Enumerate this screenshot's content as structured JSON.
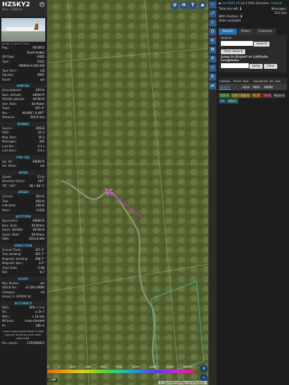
{
  "aircraft": {
    "registration": "HZSKY2",
    "hex_label": "Hex:",
    "hex": "719023",
    "photo_credit": "Image © Jose M. Deza",
    "rows_id": [
      {
        "k": "Reg.:",
        "v": "HZ-SKY2"
      },
      {
        "k": "",
        "v": "Saudi Arabia"
      },
      {
        "k": "DB flags:",
        "v": "LADD"
      },
      {
        "k": "Type:",
        "v": "A332"
      },
      {
        "k": "",
        "v": "AIRBUS A-330-200"
      },
      {
        "k": "Type Desc.:",
        "v": "L2J"
      },
      {
        "k": "Squawk:",
        "v": "0601"
      },
      {
        "k": "Route:",
        "v": "n/a"
      }
    ]
  },
  "sections": [
    {
      "title": "SPATIAL",
      "rows": [
        {
          "k": "Groundspeed:",
          "v": "429 kt"
        },
        {
          "k": "Baro. altitude:",
          "v": "40000 ft"
        },
        {
          "k": "WGS84 altitude:",
          "v": "40700 ft"
        },
        {
          "k": "Vert. Rate:",
          "v": "-64 ft/min"
        },
        {
          "k": "Track:",
          "v": "307.4°"
        },
        {
          "k": "Pos.:",
          "v": "49.606°, 6.497°"
        },
        {
          "k": "Distance:",
          "v": "203.6 nmi"
        }
      ]
    },
    {
      "title": "SIGNAL",
      "rows": [
        {
          "k": "Source:",
          "v": "ADS-B"
        },
        {
          "k": "RSSI:",
          "v": "-25.3"
        },
        {
          "k": "Msg. Rate:",
          "v": "19.5"
        },
        {
          "k": "Messages:",
          "v": "345"
        },
        {
          "k": "Last Pos.:",
          "v": "0.1 s"
        },
        {
          "k": "Last Seen:",
          "v": "0.0 s"
        }
      ]
    },
    {
      "title": "FMS SEL",
      "rows": [
        {
          "k": "Sel. Alt.:",
          "v": "40000 ft"
        },
        {
          "k": "Sel. Head.:",
          "v": "n/a"
        }
      ]
    },
    {
      "title": "WIND",
      "rows": [
        {
          "k": "Speed:",
          "v": "53 kt"
        },
        {
          "k": "Direction (from):",
          "v": "247°"
        },
        {
          "k": "TAT / OAT:",
          "v": "-38 / -66 °C"
        }
      ]
    },
    {
      "title": "SPEED",
      "rows": [
        {
          "k": "Ground:",
          "v": "429 kt"
        },
        {
          "k": "True:",
          "v": "458 kt"
        },
        {
          "k": "Indicated:",
          "v": "248 kt"
        },
        {
          "k": "Mach:",
          "v": "0.816"
        }
      ]
    },
    {
      "title": "ALTITUDE",
      "rows": [
        {
          "k": "Barometric:",
          "v": "40000 ft"
        },
        {
          "k": "Baro. Rate:",
          "v": "-64 ft/min"
        },
        {
          "k": "Geom. WGS84:",
          "v": "40700 ft"
        },
        {
          "k": "Geom. Rate:",
          "v": "-64 ft/min"
        },
        {
          "k": "QNH:",
          "v": "1013.6 hPa"
        }
      ]
    },
    {
      "title": "DIRECTION",
      "rows": [
        {
          "k": "Ground Track:",
          "v": "307.4°"
        },
        {
          "k": "True Heading:",
          "v": "301.7°"
        },
        {
          "k": "Magnetic Heading:",
          "v": "298.7°"
        },
        {
          "k": "Magnetic Decl.:",
          "v": "3.2°"
        },
        {
          "k": "Track Rate:",
          "v": "-0.06"
        },
        {
          "k": "Roll:",
          "v": "-0.7"
        }
      ]
    },
    {
      "title": "STUFF",
      "rows": [
        {
          "k": "Nav. Modes:",
          "v": "n/a"
        },
        {
          "k": "ADS-B Ver.:",
          "v": "v2 (DO-260B)"
        },
        {
          "k": "Category:",
          "v": "A5"
        },
        {
          "k": "Heavy (> 300000 lb)",
          "v": ""
        }
      ]
    },
    {
      "title": "ACCURACY",
      "rows": [
        {
          "k": "NACₚ:",
          "v": "EPU < 3 m"
        },
        {
          "k": "SIL:",
          "v": "≤ 1e-7"
        },
        {
          "k": "NACᵥ:",
          "v": "< 10 m/s"
        },
        {
          "k": "NICʙᴀʀᴏ:",
          "v": "cross-checked"
        },
        {
          "k": "Rᴄ:",
          "v": "186 m"
        }
      ]
    }
  ],
  "left_note": "Learn more about Mode S data type by hovering over each data label.",
  "pos_epoch": {
    "k": "Pos. epoch:",
    "v": "1761949022"
  },
  "map": {
    "buttons": [
      "U",
      "H",
      "T"
    ],
    "altitude_labels": [
      "ft",
      "0",
      "2000",
      "4000",
      "6000",
      "8000",
      "10000",
      "20000",
      "30000",
      "40000+"
    ],
    "scale": "2 NM",
    "attribution": "© OpenStreetMap contributors.",
    "zoom_in": "+",
    "zoom_out": "−"
  },
  "side_buttons": [
    "‹",
    "⤢",
    "I",
    "O",
    "K",
    "M",
    "P",
    "I",
    "R",
    "⇄"
  ],
  "right": {
    "version_link": "tar1090",
    "version": "(3.14.1704)",
    "decoder_label": "decoder:",
    "decoder_link": "readsb",
    "stats": [
      {
        "k": "Total Aircraft:",
        "v": "1"
      },
      {
        "k": "Messages:",
        "v": "323 /sec"
      },
      {
        "k": "With Position:",
        "v": "1"
      },
      {
        "k": "Stats available",
        "v": ""
      }
    ],
    "tabs": [
      "Search",
      "Filters",
      "Columns"
    ],
    "search_label": "Search:",
    "search_button": "Search",
    "clear_search": "Clear Search",
    "jump_label": "Jump to Airport or Latitude, Longitude:",
    "jump_button": "Jump",
    "clear_button": "Clear",
    "table_headers": [
      "Callsign",
      "Route",
      "Type",
      "Squawk",
      "Alt. (ft)",
      "Spd"
    ],
    "table_rows": [
      {
        "callsign": "HZSKY2",
        "route": "",
        "type": "A332",
        "squawk": "0601",
        "alt": "40000",
        "spd": ""
      }
    ],
    "source_filters": [
      "ADS-B",
      "UAT / ADS-R",
      "MLAT",
      "TIS-B",
      "Mode-S",
      "AIS",
      "ADS-C"
    ]
  },
  "colors": {
    "accent": "#4fb3e8",
    "track": "#c12ad8",
    "panel": "#1e1e1e"
  }
}
